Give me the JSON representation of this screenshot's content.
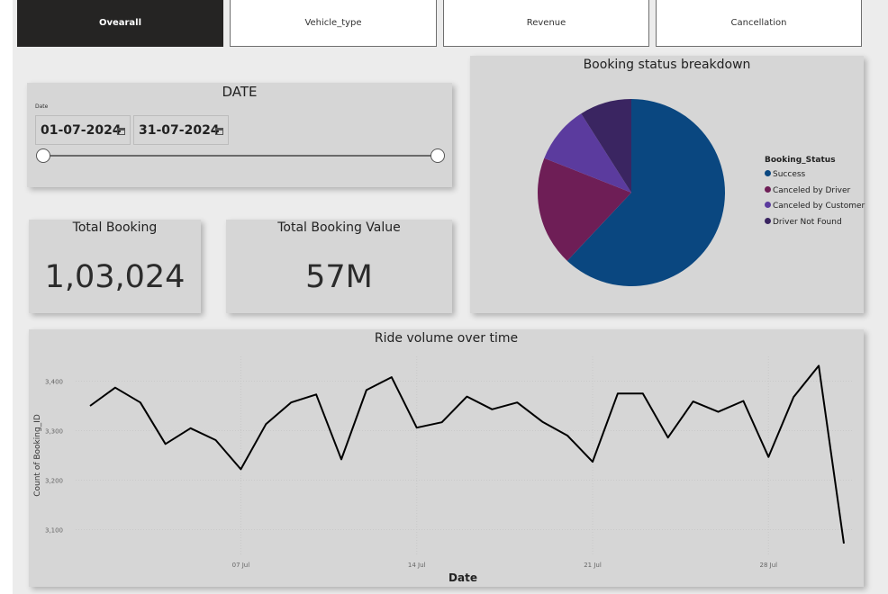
{
  "tabs": [
    "Ovearall",
    "Vehicle_type",
    "Revenue",
    "Cancellation"
  ],
  "date_filter": {
    "title": "DATE",
    "field_label": "Date",
    "start": "01-07-2024",
    "end": "31-07-2024",
    "slider_start": 0,
    "slider_end": 1
  },
  "kpis": {
    "total_booking_label": "Total Booking",
    "total_booking_value": "1,03,024",
    "total_value_label": "Total Booking Value",
    "total_value_value": "57M"
  },
  "chart_data": [
    {
      "type": "pie",
      "title": "Booking status breakdown",
      "legend_title": "Booking_Status",
      "legend_position": "right",
      "labels": [
        "Success",
        "Canceled by Driver",
        "Canceled by Customer",
        "Driver Not Found"
      ],
      "values": [
        62,
        19,
        10,
        9
      ],
      "colors": [
        "#0a4780",
        "#6e1e56",
        "#5b3b9e",
        "#3a2561"
      ]
    },
    {
      "type": "line",
      "title": "Ride volume over time",
      "xlabel": "Date",
      "ylabel": "Count of Booking_ID",
      "x": [
        "2024-07-01",
        "2024-07-02",
        "2024-07-03",
        "2024-07-04",
        "2024-07-05",
        "2024-07-06",
        "2024-07-07",
        "2024-07-08",
        "2024-07-09",
        "2024-07-10",
        "2024-07-11",
        "2024-07-12",
        "2024-07-13",
        "2024-07-14",
        "2024-07-15",
        "2024-07-16",
        "2024-07-17",
        "2024-07-18",
        "2024-07-19",
        "2024-07-20",
        "2024-07-21",
        "2024-07-22",
        "2024-07-23",
        "2024-07-24",
        "2024-07-25",
        "2024-07-26",
        "2024-07-27",
        "2024-07-28",
        "2024-07-29",
        "2024-07-30",
        "2024-07-31"
      ],
      "y": [
        3350,
        3387,
        3357,
        3273,
        3305,
        3281,
        3222,
        3313,
        3357,
        3373,
        3242,
        3382,
        3408,
        3306,
        3317,
        3369,
        3343,
        3357,
        3318,
        3290,
        3237,
        3375,
        3375,
        3286,
        3359,
        3338,
        3360,
        3247,
        3368,
        3431,
        3072
      ],
      "xticks": [
        "07 Jul",
        "14 Jul",
        "21 Jul",
        "28 Jul"
      ],
      "yticks": [
        "3,100",
        "3,200",
        "3,300",
        "3,400"
      ],
      "ylim": [
        3050,
        3450
      ],
      "grid": true,
      "line_color": "#000000"
    }
  ]
}
